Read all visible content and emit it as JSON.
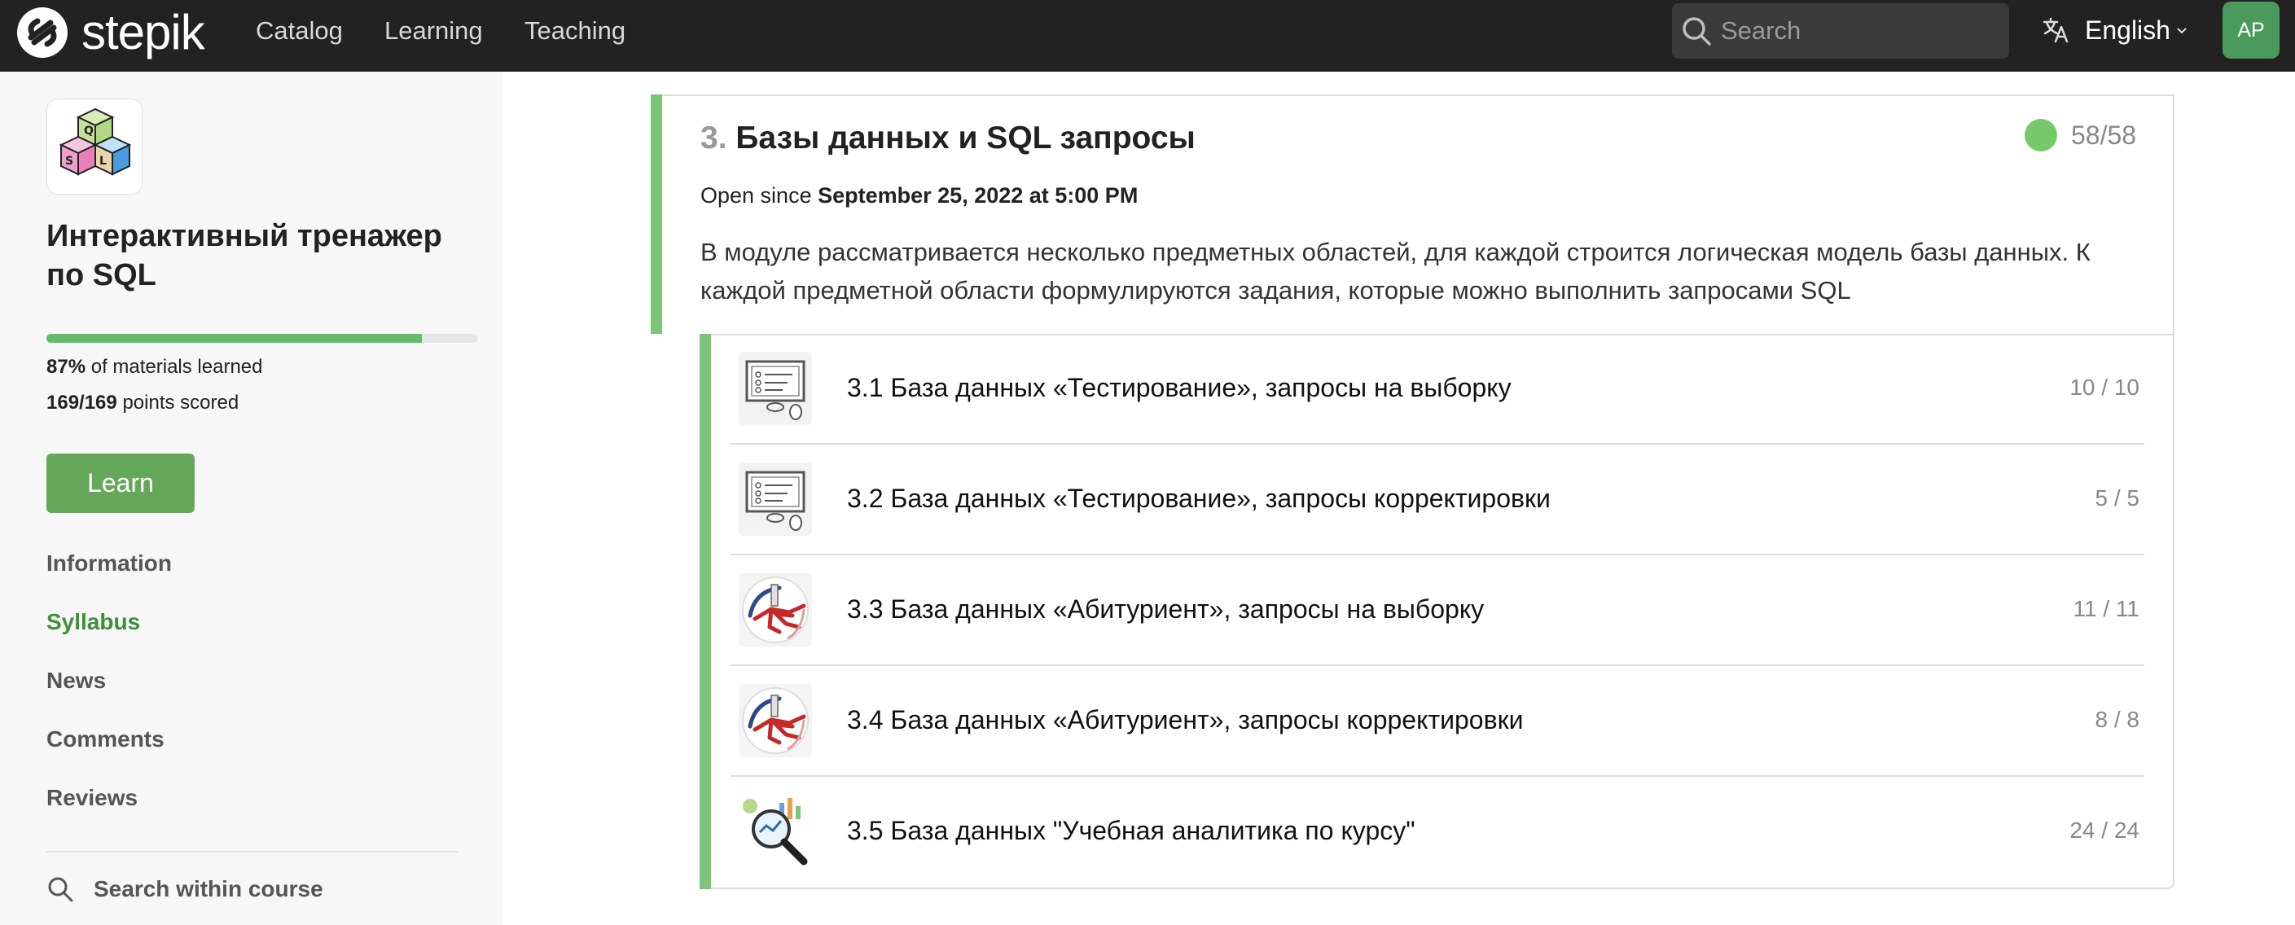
{
  "brand": {
    "name": "stepik"
  },
  "nav": {
    "items": [
      "Catalog",
      "Learning",
      "Teaching"
    ],
    "search_placeholder": "Search",
    "language": "English",
    "avatar_initials": "AP"
  },
  "colors": {
    "topbar": "#222222",
    "accent_green": "#7cc576",
    "button_green": "#66a85a",
    "active_link": "#3e8e3a"
  },
  "sidebar": {
    "course_title": "Интерактивный тренажер по SQL",
    "progress": {
      "percent": 87,
      "percent_label": "87%",
      "percent_suffix": "of materials learned"
    },
    "points": {
      "value": "169/169",
      "suffix": "points scored"
    },
    "learn_label": "Learn",
    "links": [
      {
        "label": "Information",
        "active": false
      },
      {
        "label": "Syllabus",
        "active": true
      },
      {
        "label": "News",
        "active": false
      },
      {
        "label": "Comments",
        "active": false
      },
      {
        "label": "Reviews",
        "active": false
      }
    ],
    "search_label": "Search within course"
  },
  "module": {
    "number": "3.",
    "title": "Базы данных и SQL запросы",
    "score": "58/58",
    "open_since_prefix": "Open since",
    "open_since_date": "September 25, 2022 at 5:00 PM",
    "description": "В модуле рассматривается несколько предметных областей, для каждой строится логическая модель базы данных. К каждой предметной области формулируются задания, которые можно выполнить запросами SQL",
    "lessons": [
      {
        "title": "3.1 База данных «Тестирование», запросы на выборку",
        "score": "10 / 10",
        "icon": "test-monitor-icon"
      },
      {
        "title": "3.2 База данных «Тестирование», запросы корректировки",
        "score": "5 / 5",
        "icon": "test-monitor-icon"
      },
      {
        "title": "3.3 База данных «Абитуриент», запросы на выборку",
        "score": "11 / 11",
        "icon": "graduate-icon"
      },
      {
        "title": "3.4 База данных «Абитуриент», запросы корректировки",
        "score": "8 / 8",
        "icon": "graduate-icon"
      },
      {
        "title": "3.5 База данных \"Учебная аналитика по курсу\"",
        "score": "24 / 24",
        "icon": "analytics-magnifier-icon"
      }
    ]
  }
}
